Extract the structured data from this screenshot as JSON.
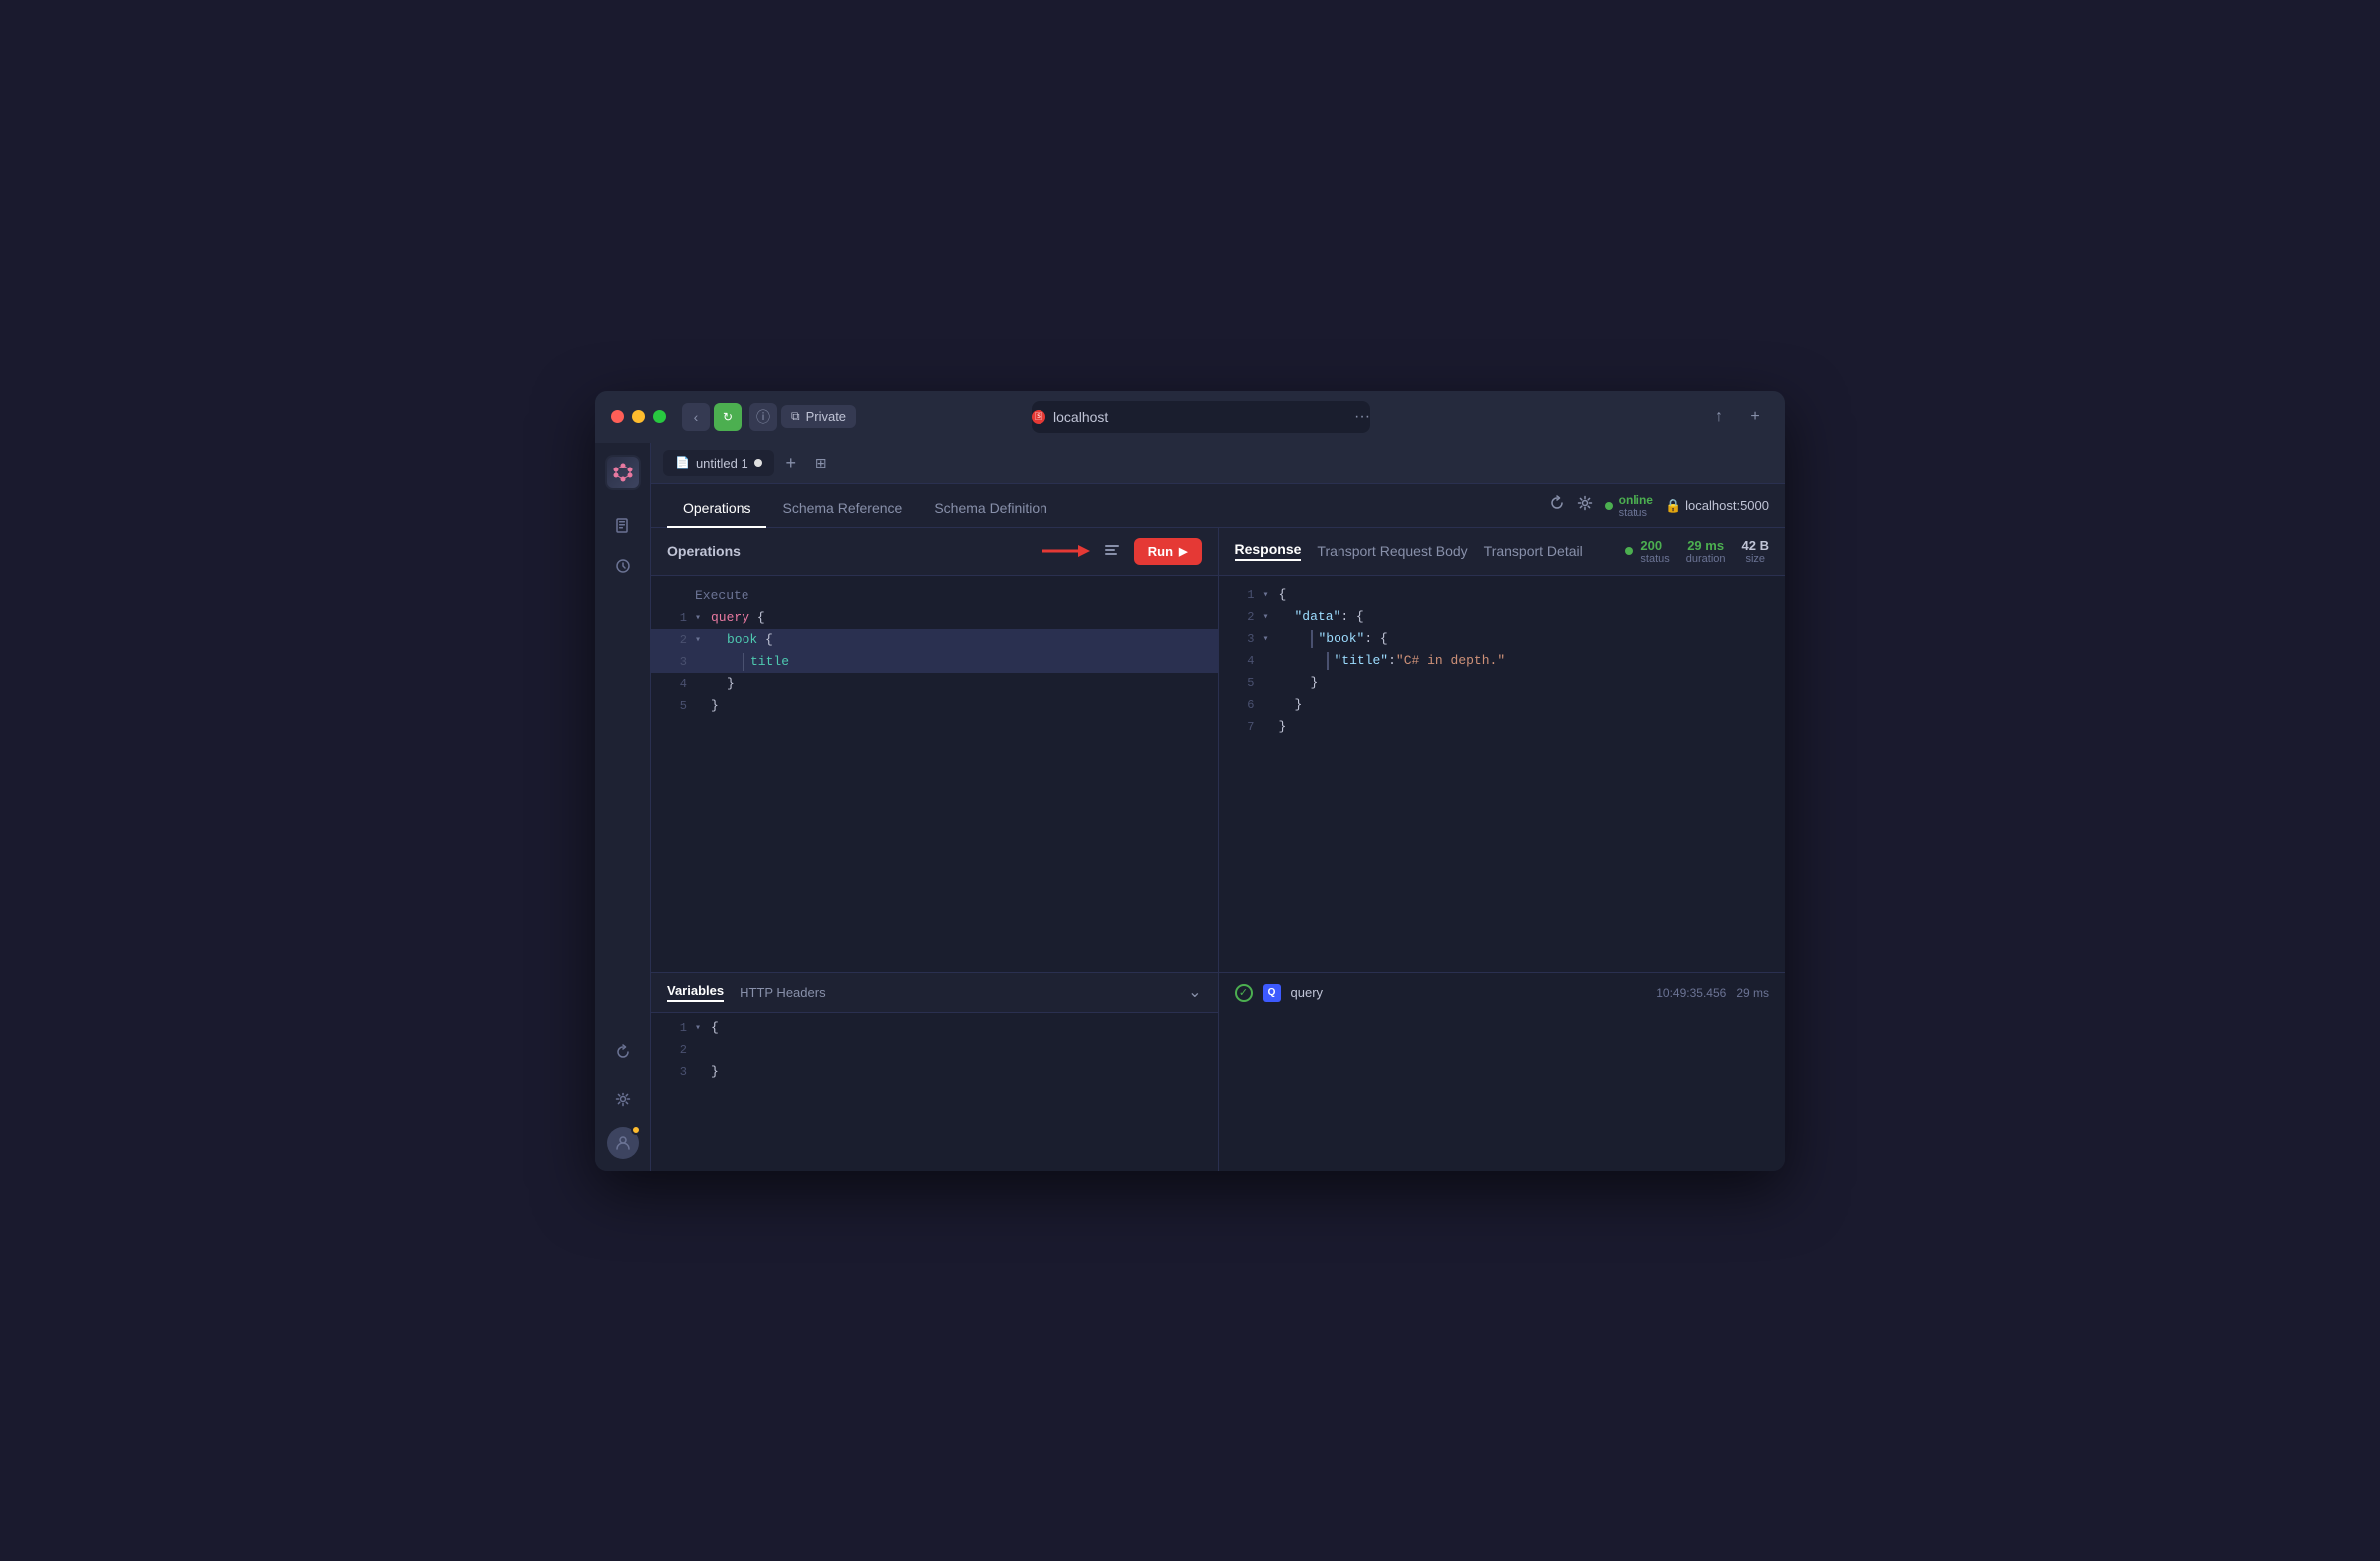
{
  "window": {
    "title": "localhost"
  },
  "titlebar": {
    "private_label": "Private",
    "address": "localhost",
    "share_icon": "↑",
    "new_tab_icon": "+"
  },
  "sidebar": {
    "logo_alt": "GraphQL IDE",
    "items": [
      {
        "id": "documents",
        "icon": "📄",
        "label": "Documents"
      },
      {
        "id": "history",
        "icon": "🕐",
        "label": "History"
      }
    ],
    "bottom_items": [
      {
        "id": "refresh",
        "icon": "↻",
        "label": "Refresh"
      },
      {
        "id": "settings",
        "icon": "⚙",
        "label": "Settings"
      },
      {
        "id": "profile",
        "icon": "👤",
        "label": "Profile"
      }
    ]
  },
  "tabs": {
    "current": {
      "label": "untitled 1",
      "has_unsaved": true
    },
    "add_label": "+",
    "grid_label": "⊞"
  },
  "nav_tabs": {
    "items": [
      {
        "id": "operations",
        "label": "Operations",
        "active": true
      },
      {
        "id": "schema_ref",
        "label": "Schema Reference",
        "active": false
      },
      {
        "id": "schema_def",
        "label": "Schema Definition",
        "active": false
      }
    ]
  },
  "status": {
    "online_label": "online",
    "status_label": "status",
    "dot_color": "#4caf50"
  },
  "endpoint": {
    "lock_icon": "🔒",
    "url": "localhost:5000"
  },
  "operations_panel": {
    "title": "Operations",
    "execute_label": "Execute",
    "run_button": "Run",
    "code_lines": [
      {
        "num": 1,
        "indent": 0,
        "has_collapse": true,
        "text": "query {",
        "classes": [
          "code-keyword",
          "code-bracket"
        ]
      },
      {
        "num": 2,
        "indent": 1,
        "has_collapse": true,
        "text": "book {",
        "classes": [
          "code-field",
          "code-bracket"
        ]
      },
      {
        "num": 3,
        "indent": 2,
        "has_collapse": false,
        "text": "title",
        "classes": [
          "code-field"
        ]
      },
      {
        "num": 4,
        "indent": 1,
        "has_collapse": false,
        "text": "}",
        "classes": [
          "code-bracket"
        ]
      },
      {
        "num": 5,
        "indent": 0,
        "has_collapse": false,
        "text": "}",
        "classes": [
          "code-bracket"
        ]
      }
    ]
  },
  "response_panel": {
    "tabs": [
      {
        "id": "response",
        "label": "Response",
        "active": true
      },
      {
        "id": "transport_request",
        "label": "Transport Request Body",
        "active": false
      },
      {
        "id": "transport_detail",
        "label": "Transport Detail",
        "active": false
      }
    ],
    "stats": {
      "status_value": "200",
      "status_label": "status",
      "duration_value": "29 ms",
      "duration_label": "duration",
      "size_value": "42 B",
      "size_label": "size"
    },
    "code_lines": [
      {
        "num": 1,
        "indent": 0,
        "has_collapse": true,
        "text": "{"
      },
      {
        "num": 2,
        "indent": 1,
        "has_collapse": true,
        "key": "\"data\"",
        "text": ": {"
      },
      {
        "num": 3,
        "indent": 2,
        "has_collapse": true,
        "key": "\"book\"",
        "text": ": {"
      },
      {
        "num": 4,
        "indent": 3,
        "has_collapse": false,
        "key": "\"title\"",
        "sep": ": ",
        "value": "\"C# in depth.\""
      },
      {
        "num": 5,
        "indent": 2,
        "has_collapse": false,
        "text": "}"
      },
      {
        "num": 6,
        "indent": 1,
        "has_collapse": false,
        "text": "}"
      },
      {
        "num": 7,
        "indent": 0,
        "has_collapse": false,
        "text": "}"
      }
    ]
  },
  "variables_panel": {
    "tabs": [
      {
        "id": "variables",
        "label": "Variables",
        "active": true
      },
      {
        "id": "http_headers",
        "label": "HTTP Headers",
        "active": false
      }
    ],
    "code_lines": [
      {
        "num": 1,
        "text": "{"
      },
      {
        "num": 2,
        "text": ""
      },
      {
        "num": 3,
        "text": "}"
      }
    ]
  },
  "history_panel": {
    "items": [
      {
        "id": 1,
        "status": "success",
        "type": "query",
        "name": "query",
        "timestamp": "10:49:35.456",
        "duration": "29 ms"
      }
    ]
  }
}
